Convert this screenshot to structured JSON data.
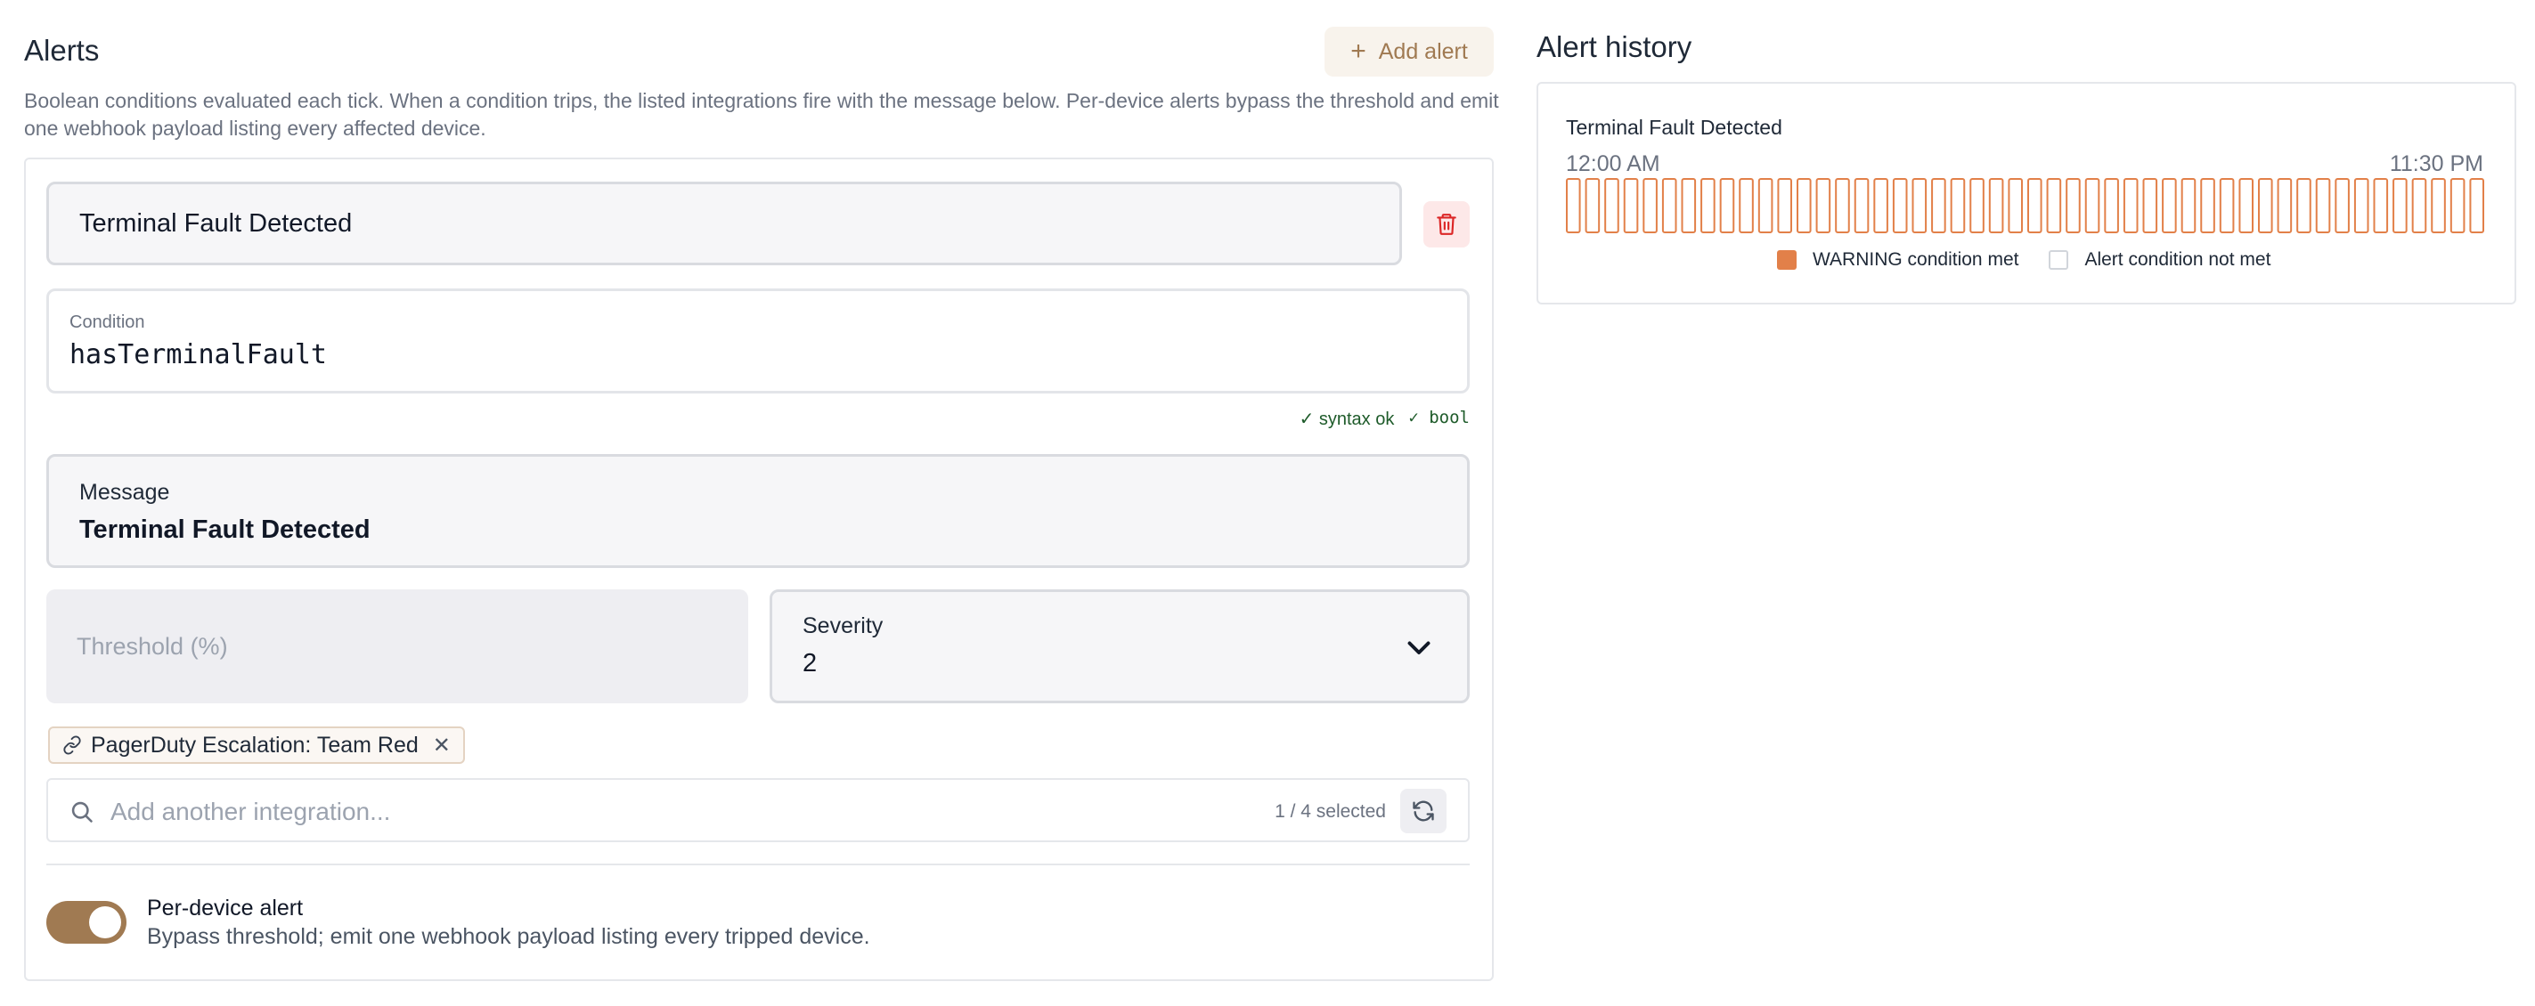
{
  "alerts": {
    "title": "Alerts",
    "add_button_label": "Add alert",
    "description": "Boolean conditions evaluated each tick. When a condition trips, the listed integrations fire with the message below. Per-device alerts bypass the threshold and emit one webhook payload listing every affected device."
  },
  "alert": {
    "name": "Terminal Fault Detected",
    "condition_label": "Condition",
    "condition_value": "hasTerminalFault",
    "syntax_ok": "✓ syntax ok",
    "type_ok": "✓ bool",
    "message_label": "Message",
    "message_value": "Terminal Fault Detected",
    "threshold_placeholder": "Threshold (%)",
    "severity_label": "Severity",
    "severity_value": "2",
    "integration_chip": "PagerDuty Escalation: Team Red",
    "integration_search_placeholder": "Add another integration...",
    "integration_count": "1 / 4 selected",
    "per_device_title": "Per-device alert",
    "per_device_desc": "Bypass threshold; emit one webhook payload listing every tripped device.",
    "per_device_enabled": true
  },
  "history": {
    "title": "Alert history",
    "alert_name": "Terminal Fault Detected",
    "time_start": "12:00 AM",
    "time_end": "11:30 PM",
    "bucket_count": 48,
    "met_buckets": 0,
    "legend_met": "WARNING condition met",
    "legend_not_met": "Alert condition not met"
  },
  "colors": {
    "accent": "#a07a52",
    "warning": "#e28049",
    "danger": "#dc2626",
    "ok": "#1e5b2a"
  },
  "icons": {
    "add": "plus-icon",
    "delete": "trash-icon",
    "severity": "chevron-down-icon",
    "chip": "link-icon",
    "chip_remove": "close-icon",
    "search": "search-icon",
    "refresh": "refresh-icon"
  }
}
